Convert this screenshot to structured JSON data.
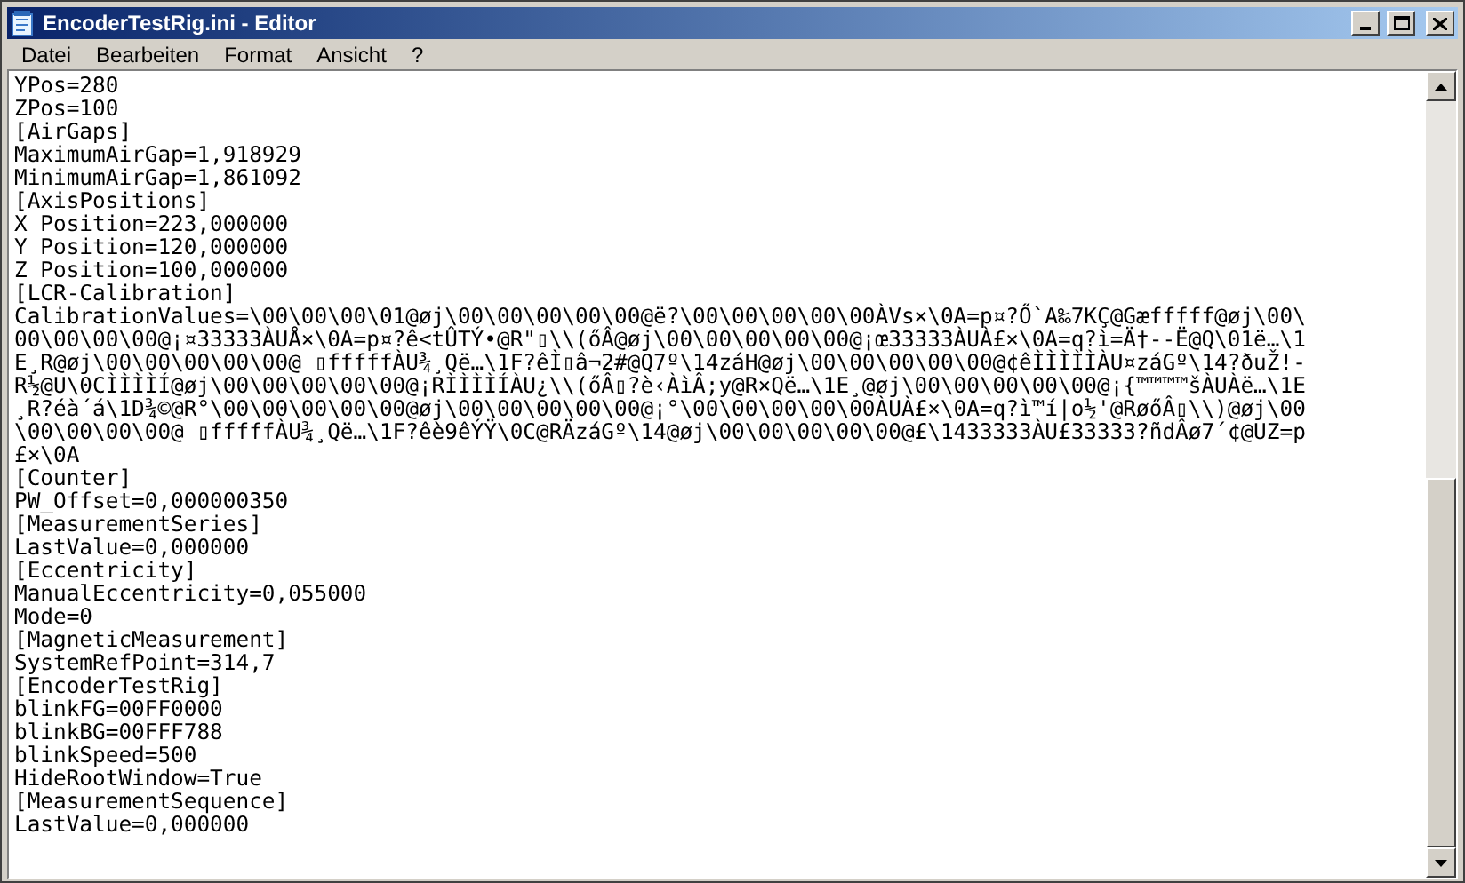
{
  "window": {
    "title": "EncoderTestRig.ini - Editor"
  },
  "menu": [
    "Datei",
    "Bearbeiten",
    "Format",
    "Ansicht",
    "?"
  ],
  "lines": [
    "YPos=280",
    "ZPos=100",
    "[AirGaps]",
    "MaximumAirGap=1,918929",
    "MinimumAirGap=1,861092",
    "[AxisPositions]",
    "X Position=223,000000",
    "Y Position=120,000000",
    "Z Position=100,000000",
    "[LCR-Calibration]",
    "CalibrationValues=\\00\\00\\00\\01@øj\\00\\00\\00\\00\\00@ë?\\00\\00\\00\\00\\00ÀVs×\\0A=p¤?Ő`A‰7KÇ@Gæfffff@øj\\00\\",
    "00\\00\\00\\00@¡¤33333ÀUÅ×\\0A=p¤?ê<tÛTÝ•@R\"▯\\\\(őÂ@øj\\00\\00\\00\\00\\00@¡œ33333ÀUÀ£×\\0A=q?ì=Ä†--Ë@Q\\01ë…\\1",
    "E¸R@øj\\00\\00\\00\\00\\00@ ▯fffffÀU¾¸Që…\\1F?êÌ▯â¬2#@Q7º\\14záH@øj\\00\\00\\00\\00\\00@¢êÌÌÌÌÌÀU¤záGº\\14?ðuŽ!-",
    "R½@U\\0CÌÌÌÌÍ@øj\\00\\00\\00\\00\\00@¡RÌÌÌÌÍÀU¿\\\\(őÂ▯?è‹ÀìÂ;y@R×Që…\\1E¸@øj\\00\\00\\00\\00\\00@¡{™™™™šÀUÀë…\\1E",
    "¸R?éà´á\\1D¾©@R°\\00\\00\\00\\00\\00@øj\\00\\00\\00\\00\\00@¡°\\00\\00\\00\\00\\00ÀUÀ£×\\0A=q?ì™í|o½'@RøőÂ▯\\\\)@øj\\00",
    "\\00\\00\\00\\00@ ▯fffffÀU¾¸Që…\\1F?êè9êÝŸ\\0C@RÄzáGº\\14@øj\\00\\00\\00\\00\\00@£\\1433333ÀU£33333?ñdÂø7´¢@UZ=p",
    "£×\\0A",
    "[Counter]",
    "PW_Offset=0,000000350",
    "[MeasurementSeries]",
    "LastValue=0,000000",
    "[Eccentricity]",
    "ManualEccentricity=0,055000",
    "Mode=0",
    "[MagneticMeasurement]",
    "SystemRefPoint=314,7",
    "[EncoderTestRig]",
    "blinkFG=00FF0000",
    "blinkBG=00FFF788",
    "blinkSpeed=500",
    "HideRootWindow=True",
    "[MeasurementSequence]",
    "LastValue=0,000000"
  ]
}
